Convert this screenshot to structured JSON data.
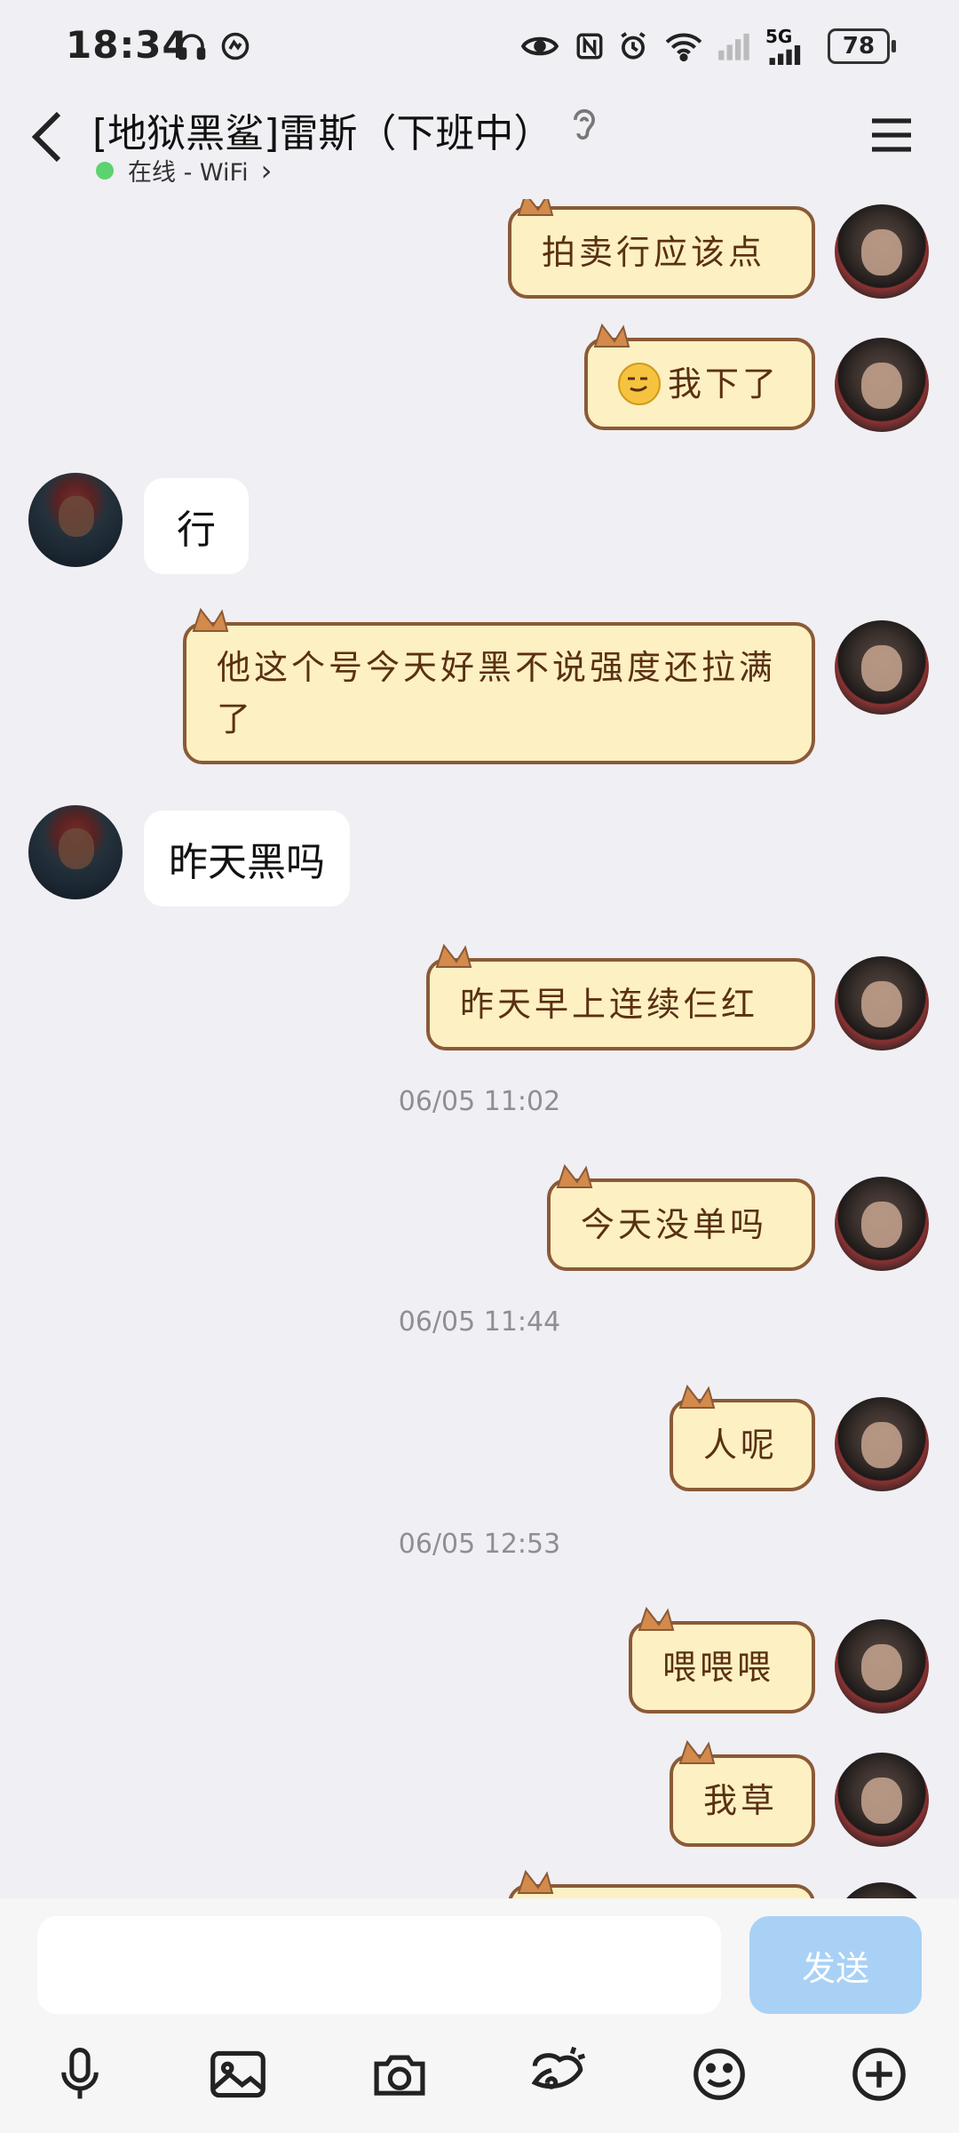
{
  "status_bar": {
    "time": "18:34",
    "network": "5G",
    "battery": "78",
    "icons": [
      "headphones-icon",
      "app-badge-icon",
      "eye-icon",
      "nfc-icon",
      "alarm-icon",
      "wifi-icon",
      "signal-icon"
    ]
  },
  "header": {
    "title": "[地狱黑鲨]雷斯（下班中）",
    "status_text": "在线 - WiFi",
    "status_chevron": "›",
    "status_color": "#5dd36f"
  },
  "messages": [
    {
      "side": "me",
      "text": "拍卖行应该点"
    },
    {
      "side": "me",
      "text": "我下了",
      "emoji": "smirk"
    },
    {
      "side": "other",
      "text": "行"
    },
    {
      "side": "me",
      "text": "他这个号今天好黑不说强度还拉满了"
    },
    {
      "side": "other",
      "text": "昨天黑吗"
    },
    {
      "side": "me",
      "text": "昨天早上连续仨红"
    },
    {
      "side": "time",
      "text": "06/05 11:02"
    },
    {
      "side": "me",
      "text": "今天没单吗"
    },
    {
      "side": "time",
      "text": "06/05 11:44"
    },
    {
      "side": "me",
      "text": "人呢"
    },
    {
      "side": "time",
      "text": "06/05 12:53"
    },
    {
      "side": "me",
      "text": "喂喂喂"
    },
    {
      "side": "me",
      "text": "我草"
    }
  ],
  "input": {
    "placeholder": "",
    "send_label": "发送"
  },
  "toolbar": [
    "mic-icon",
    "image-icon",
    "camera-icon",
    "red-packet-icon",
    "emoji-icon",
    "plus-icon"
  ],
  "colors": {
    "background": "#f0eff4",
    "bubble_cat_fill": "#fdf0c3",
    "bubble_cat_border": "#8a5a36",
    "send_button": "#a9d1f5",
    "timestamp": "#8e8e93"
  }
}
